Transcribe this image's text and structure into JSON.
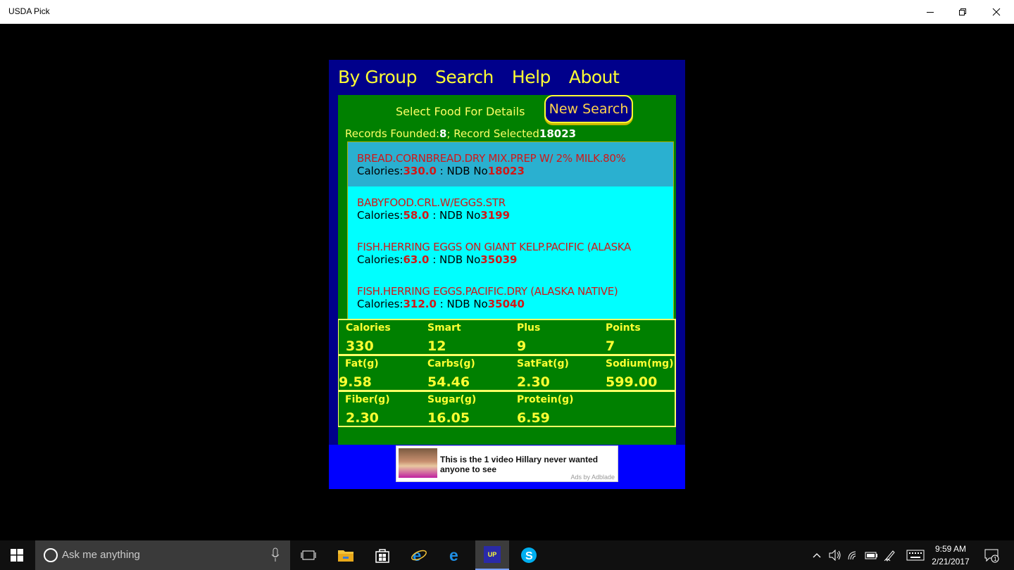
{
  "window": {
    "title": "USDA Pick"
  },
  "nav": {
    "items": [
      "By Group",
      "Search",
      "Help",
      "About"
    ]
  },
  "panel": {
    "select_label": "Select Food For Details",
    "new_search_label": "New Search",
    "records_label": "Records Founded:",
    "records_count": "8",
    "selected_label": "; Record Selected",
    "selected_id": "18023"
  },
  "foods": [
    {
      "name": "BREAD.CORNBREAD.DRY MIX.PREP W/ 2% MILK.80%",
      "calories_label": "Calories:",
      "calories": "330.0",
      "ndb_label": " : NDB  No",
      "ndb": "18023",
      "selected": true
    },
    {
      "name": "BABYFOOD.CRL.W/EGGS.STR",
      "calories_label": "Calories:",
      "calories": "58.0",
      "ndb_label": " : NDB  No",
      "ndb": "3199",
      "selected": false
    },
    {
      "name": "FISH.HERRING EGGS ON GIANT KELP.PACIFIC (ALASKA",
      "calories_label": "Calories:",
      "calories": "63.0",
      "ndb_label": " : NDB  No",
      "ndb": "35039",
      "selected": false
    },
    {
      "name": "FISH.HERRING EGGS.PACIFIC.DRY (ALASKA NATIVE)",
      "calories_label": "Calories:",
      "calories": "312.0",
      "ndb_label": " : NDB  No",
      "ndb": "35040",
      "selected": false
    }
  ],
  "nutrition": {
    "row1": {
      "h": [
        "Calories",
        "Smart",
        "Plus",
        "Points"
      ],
      "v": [
        "330",
        "12",
        "9",
        "7"
      ]
    },
    "row2": {
      "h": [
        "Fat(g)",
        "Carbs(g)",
        "SatFat(g)",
        "Sodium(mg)"
      ],
      "v": [
        "9.58",
        "54.46",
        "2.30",
        "599.00"
      ]
    },
    "row3": {
      "h": [
        "Fiber(g)",
        "Sugar(g)",
        "Protein(g)",
        ""
      ],
      "v": [
        "2.30",
        "16.05",
        "6.59",
        ""
      ]
    }
  },
  "ad": {
    "text": "This is the 1 video Hillary never wanted anyone to see",
    "by": "Ads by Adblade"
  },
  "taskbar": {
    "search_placeholder": "Ask me anything",
    "time": "9:59 AM",
    "date": "2/21/2017",
    "notifications": "1",
    "app_badge": "UP"
  },
  "colors": {
    "nav_text": "#ffff33",
    "panel_bg": "#008000",
    "list_bg": "#00ffff",
    "selected_bg": "#2ab0d0",
    "food_name": "#d01818",
    "frame_bg": "#00008b",
    "ad_bar": "#0000ff"
  }
}
